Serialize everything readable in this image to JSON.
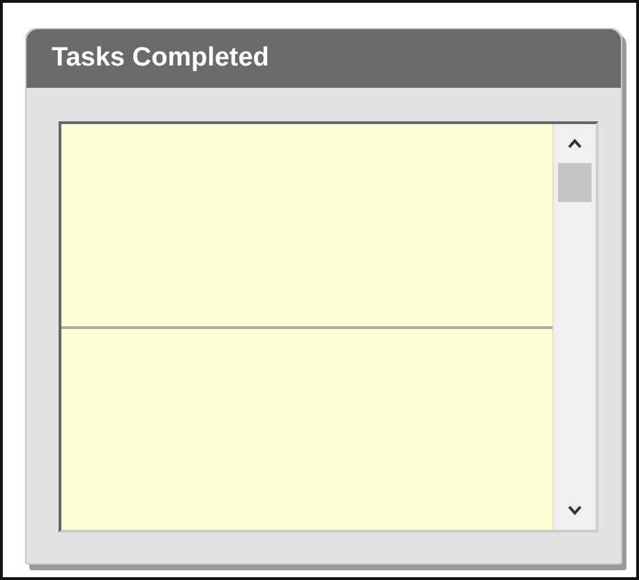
{
  "panel": {
    "title": "Tasks Completed"
  }
}
